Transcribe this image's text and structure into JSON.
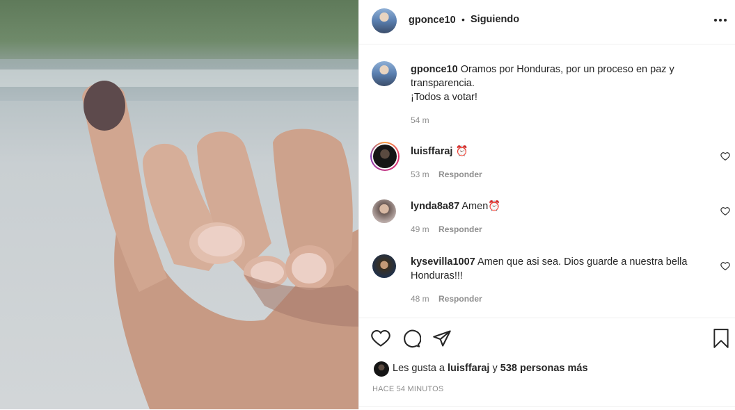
{
  "post": {
    "username": "gponce10",
    "separator": "•",
    "follow_status": "Siguiendo",
    "more_icon": "more-horizontal-icon",
    "caption_line1": "Oramos por Honduras, por un proceso en paz y",
    "caption_line2": "transparencia.",
    "caption_line3": "¡Todos a votar!",
    "caption_time": "54 m"
  },
  "comments": [
    {
      "username": "luisffaraj",
      "text": "⏰",
      "time": "53 m",
      "reply": "Responder"
    },
    {
      "username": "lynda8a87",
      "text": "Amen⏰",
      "time": "49 m",
      "reply": "Responder"
    },
    {
      "username": "kysevilla1007",
      "text_line1": "Amen que asi sea. Dios guarde a nuestra bella",
      "text_line2": "Honduras!!!",
      "time": "48 m",
      "reply": "Responder"
    }
  ],
  "actions": {
    "icons": [
      "heart-icon",
      "comment-icon",
      "share-icon",
      "bookmark-icon"
    ],
    "likes_prefix": "Les gusta a",
    "likes_user": "luisffaraj",
    "likes_mid": "y",
    "likes_count": "538 personas más",
    "timestamp": "HACE 54 MINUTOS"
  },
  "colors": {
    "text": "#262626",
    "muted": "#8e8e8e",
    "border": "#efefef"
  }
}
